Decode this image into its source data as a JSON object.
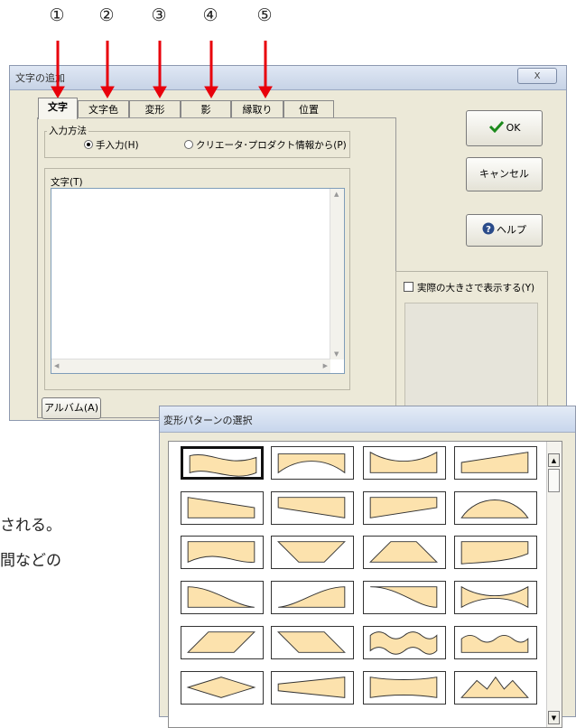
{
  "callouts": [
    "①",
    "②",
    "③",
    "④",
    "⑤"
  ],
  "dialog": {
    "title": "文字の追加",
    "close_label": "X",
    "tabs": [
      "文字",
      "文字色",
      "変形",
      "影",
      "縁取り",
      "位置"
    ],
    "input_method": {
      "label": "入力方法",
      "options": [
        "手入力(H)",
        "クリエータ･プロダクト情報から(P)"
      ]
    },
    "text_label": "文字(T)",
    "album_button": "アルバム(A)",
    "ok_button": "OK",
    "cancel_button": "キャンセル",
    "help_button": "ヘルプ",
    "actual_size_checkbox": "実際の大きさで表示する(Y)"
  },
  "background_text": [
    "される。",
    "間などの"
  ],
  "popup": {
    "title": "変形パターンの選択",
    "selected_index": 0,
    "pattern_count": 20
  },
  "colors": {
    "arrow": "#e8000b",
    "shape_fill": "#fce2ad",
    "dialog_bg": "#ece9d8",
    "ok_check": "#1c8a1c",
    "help_icon": "#2a4b8a"
  }
}
